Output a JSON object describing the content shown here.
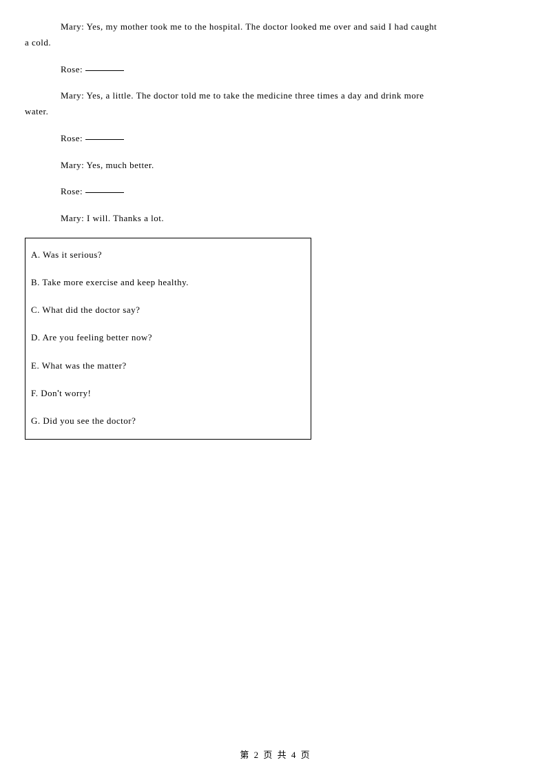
{
  "dialogue": {
    "line1_speaker": "Mary: ",
    "line1_text_a": "Yes, my mother took me to the hospital. The doctor looked me over and said I had caught",
    "line1_text_b": "a cold.",
    "line2_speaker": "Rose: ",
    "line3_speaker": "Mary: ",
    "line3_text_a": "Yes, a little. The doctor told me to take the medicine three times a day and drink more",
    "line3_text_b": "water.",
    "line4_speaker": "Rose: ",
    "line5_speaker": "Mary: ",
    "line5_text": "Yes, much better.",
    "line6_speaker": "Rose: ",
    "line7_speaker": "Mary: ",
    "line7_text": "I will. Thanks a lot."
  },
  "options": {
    "a": "A. Was it serious?",
    "b": "B. Take more exercise and keep healthy.",
    "c": "C. What did the doctor say?",
    "d": "D. Are you feeling better now?",
    "e": "E. What was the matter?",
    "f_prefix": "F. Don",
    "f_apostrophe": "'",
    "f_suffix": "t worry!",
    "g": "G. Did you see the doctor?"
  },
  "footer": {
    "text": "第 2 页 共 4 页"
  }
}
